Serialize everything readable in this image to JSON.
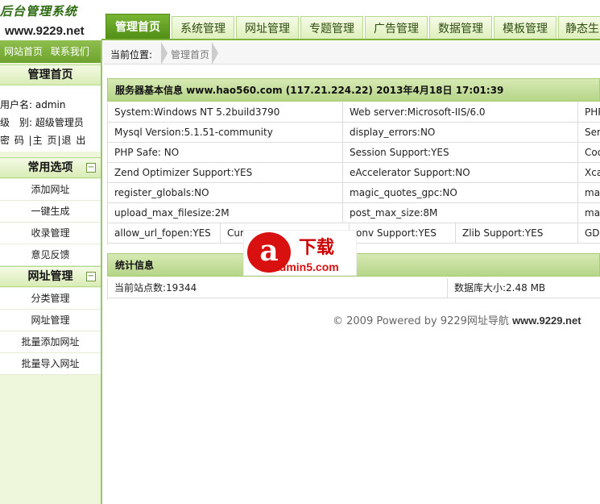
{
  "logo": {
    "title": "后台管理系统",
    "url": "www.9229.net"
  },
  "topnav": {
    "tabs": [
      "管理首页",
      "系统管理",
      "网址管理",
      "专题管理",
      "广告管理",
      "数据管理",
      "模板管理",
      "静态生"
    ]
  },
  "sidebar": {
    "links": [
      "网站首页",
      "联系我们"
    ],
    "home_title": "管理首页",
    "user_label": "用户名:",
    "user_value": "admin",
    "level_label": "级　别:",
    "level_value": "超级管理员",
    "actions": "密 码 |主 页|退 出",
    "sec1_title": "常用选项",
    "sec1_items": [
      "添加网址",
      "一键生成",
      "收录管理",
      "意见反馈"
    ],
    "sec2_title": "网址管理",
    "sec2_items": [
      "分类管理",
      "网址管理",
      "批量添加网址",
      "批量导入网址"
    ],
    "toggle": "−"
  },
  "breadcrumb": {
    "label": "当前位置:",
    "current": "管理首页"
  },
  "server": {
    "title": "服务器基本信息 www.hao560.com (117.21.224.22)   2013年4月18日 17:01:39",
    "rows": [
      [
        "System:Windows NT 5.2build3790",
        "Web server:Microsoft-IIS/6.0",
        "PHP"
      ],
      [
        "Mysql Version:5.1.51-community",
        "display_errors:NO",
        "Ser"
      ],
      [
        "PHP Safe: NO",
        "Session Support:YES",
        "Coo"
      ],
      [
        "Zend Optimizer Support:YES",
        "eAccelerator Support:NO",
        "Xca"
      ],
      [
        "register_globals:NO",
        "magic_quotes_gpc:NO",
        "mag"
      ],
      [
        "upload_max_filesize:2M",
        "post_max_size:8M",
        "max"
      ]
    ],
    "last_row": [
      "allow_url_fopen:YES",
      "Cur",
      "onv Support:YES",
      "Zlib Support:YES",
      "GD"
    ]
  },
  "stats": {
    "title": "统计信息",
    "sites": "当前站点数:19344",
    "dbsize": "数据库大小:2.48 MB"
  },
  "watermark": {
    "letter": "a",
    "text": "下载",
    "site": "admin5.com"
  },
  "footer": {
    "text": "© 2009 Powered by 9229网址导航",
    "site": "www.9229.net"
  }
}
